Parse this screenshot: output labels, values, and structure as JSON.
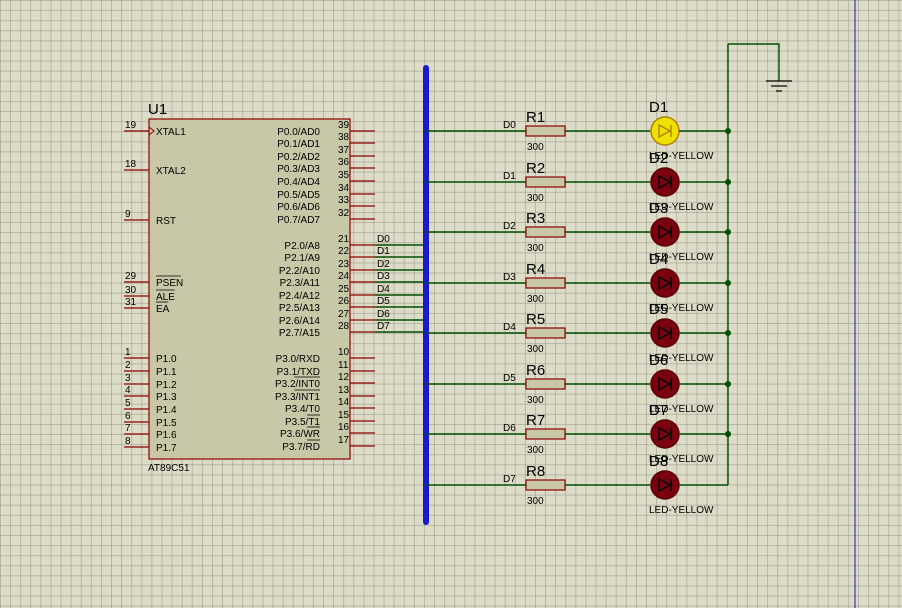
{
  "colors": {
    "grid_bg": "#dcdcc8",
    "chip_fill": "#c8c8a8",
    "pin_color": "#8b0000",
    "wire": "#004f00",
    "bus": "#1a1acc",
    "led_off": "#7a0010",
    "led_on": "#f0e000",
    "border_line": "#1a1ab4"
  },
  "chip": {
    "ref": "U1",
    "part": "AT89C51",
    "left_pins": [
      {
        "num": "19",
        "label": "XTAL1",
        "clock": true
      },
      {
        "num": "18",
        "label": "XTAL2"
      },
      {
        "num": "9",
        "label": "RST"
      },
      {
        "num": "29",
        "label": "PSEN",
        "overbar": true
      },
      {
        "num": "30",
        "label": "ALE",
        "overbar": true
      },
      {
        "num": "31",
        "label": "EA",
        "overbar": true
      },
      {
        "num": "1",
        "label": "P1.0"
      },
      {
        "num": "2",
        "label": "P1.1"
      },
      {
        "num": "3",
        "label": "P1.2"
      },
      {
        "num": "4",
        "label": "P1.3"
      },
      {
        "num": "5",
        "label": "P1.4"
      },
      {
        "num": "6",
        "label": "P1.5"
      },
      {
        "num": "7",
        "label": "P1.6"
      },
      {
        "num": "8",
        "label": "P1.7"
      }
    ],
    "right_pins": [
      {
        "num": "39",
        "label": "P0.0/AD0"
      },
      {
        "num": "38",
        "label": "P0.1/AD1"
      },
      {
        "num": "37",
        "label": "P0.2/AD2"
      },
      {
        "num": "36",
        "label": "P0.3/AD3"
      },
      {
        "num": "35",
        "label": "P0.4/AD4"
      },
      {
        "num": "34",
        "label": "P0.5/AD5"
      },
      {
        "num": "33",
        "label": "P0.6/AD6"
      },
      {
        "num": "32",
        "label": "P0.7/AD7"
      },
      {
        "num": "21",
        "label": "P2.0/A8",
        "net": "D0"
      },
      {
        "num": "22",
        "label": "P2.1/A9",
        "net": "D1"
      },
      {
        "num": "23",
        "label": "P2.2/A10",
        "net": "D2"
      },
      {
        "num": "24",
        "label": "P2.3/A11",
        "net": "D3"
      },
      {
        "num": "25",
        "label": "P2.4/A12",
        "net": "D4"
      },
      {
        "num": "26",
        "label": "P2.5/A13",
        "net": "D5"
      },
      {
        "num": "27",
        "label": "P2.6/A14",
        "net": "D6"
      },
      {
        "num": "28",
        "label": "P2.7/A15",
        "net": "D7"
      },
      {
        "num": "10",
        "label": "P3.0/RXD"
      },
      {
        "num": "11",
        "label": "P3.1/TXD"
      },
      {
        "num": "12",
        "label": "P3.2/INT0",
        "bar": "INT0"
      },
      {
        "num": "13",
        "label": "P3.3/INT1",
        "bar": "INT1"
      },
      {
        "num": "14",
        "label": "P3.4/T0"
      },
      {
        "num": "15",
        "label": "P3.5/T1",
        "bar": "T1"
      },
      {
        "num": "16",
        "label": "P3.6/WR",
        "bar": "WR"
      },
      {
        "num": "17",
        "label": "P3.7/RD",
        "bar": "RD"
      }
    ]
  },
  "channels": [
    {
      "net": "D0",
      "res_ref": "R1",
      "res_val": "300",
      "led_ref": "D1",
      "led_val": "LED-YELLOW",
      "lit": true
    },
    {
      "net": "D1",
      "res_ref": "R2",
      "res_val": "300",
      "led_ref": "D2",
      "led_val": "LED-YELLOW",
      "lit": false
    },
    {
      "net": "D2",
      "res_ref": "R3",
      "res_val": "300",
      "led_ref": "D3",
      "led_val": "LED-YELLOW",
      "lit": false
    },
    {
      "net": "D3",
      "res_ref": "R4",
      "res_val": "300",
      "led_ref": "D4",
      "led_val": "LED-YELLOW",
      "lit": false
    },
    {
      "net": "D4",
      "res_ref": "R5",
      "res_val": "300",
      "led_ref": "D5",
      "led_val": "LED-YELLOW",
      "lit": false
    },
    {
      "net": "D5",
      "res_ref": "R6",
      "res_val": "300",
      "led_ref": "D6",
      "led_val": "LED-YELLOW",
      "lit": false
    },
    {
      "net": "D6",
      "res_ref": "R7",
      "res_val": "300",
      "led_ref": "D7",
      "led_val": "LED-YELLOW",
      "lit": false
    },
    {
      "net": "D7",
      "res_ref": "R8",
      "res_val": "300",
      "led_ref": "D8",
      "led_val": "LED-YELLOW",
      "lit": false
    }
  ]
}
